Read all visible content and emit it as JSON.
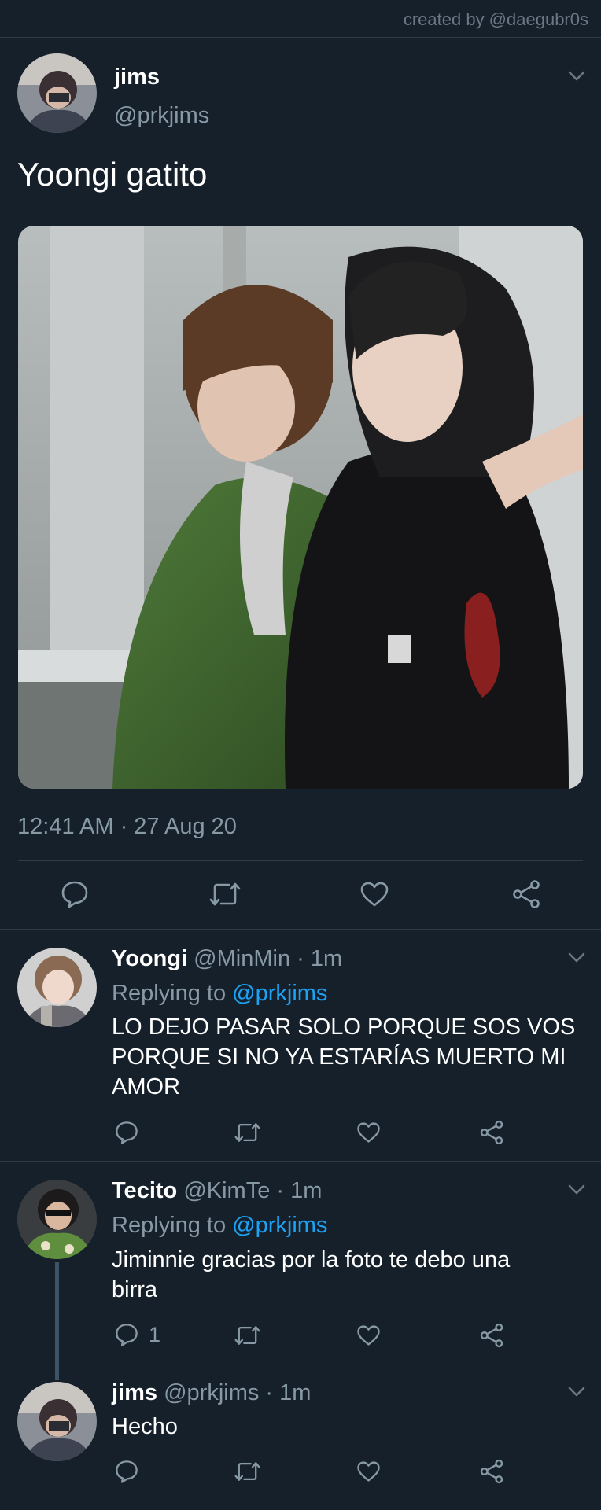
{
  "credit": "created by @daegubr0s",
  "main_tweet": {
    "display_name": "jims",
    "handle": "@prkjims",
    "text": "Yoongi gatito",
    "timestamp": "12:41 AM · 27 Aug 20"
  },
  "replies": [
    {
      "display_name": "Yoongi",
      "meta": "@MinMin · 1m",
      "replying_prefix": "Replying to",
      "replying_to": "@prkjims",
      "text_lines": [
        "LO DEJO PASAR SOLO PORQUE SOS VOS",
        "PORQUE SI NO YA ESTARÍAS MUERTO MI",
        "AMOR"
      ],
      "reply_count": ""
    },
    {
      "display_name": "Tecito",
      "meta": "@KimTe · 1m",
      "replying_prefix": "Replying to",
      "replying_to": "@prkjims",
      "text_lines": [
        "Jiminnie gracias por la foto te debo una",
        "birra"
      ],
      "reply_count": "1"
    },
    {
      "display_name": "jims",
      "meta": "@prkjims · 1m",
      "text_lines": [
        "Hecho"
      ],
      "reply_count": ""
    }
  ],
  "icons": {
    "reply": "reply-icon",
    "retweet": "retweet-icon",
    "like": "heart-icon",
    "share": "share-icon",
    "more": "chevron-down-icon"
  },
  "colors": {
    "background": "#15202b",
    "divider": "#2f3b47",
    "muted": "#8899a6",
    "link": "#1da1f2"
  }
}
